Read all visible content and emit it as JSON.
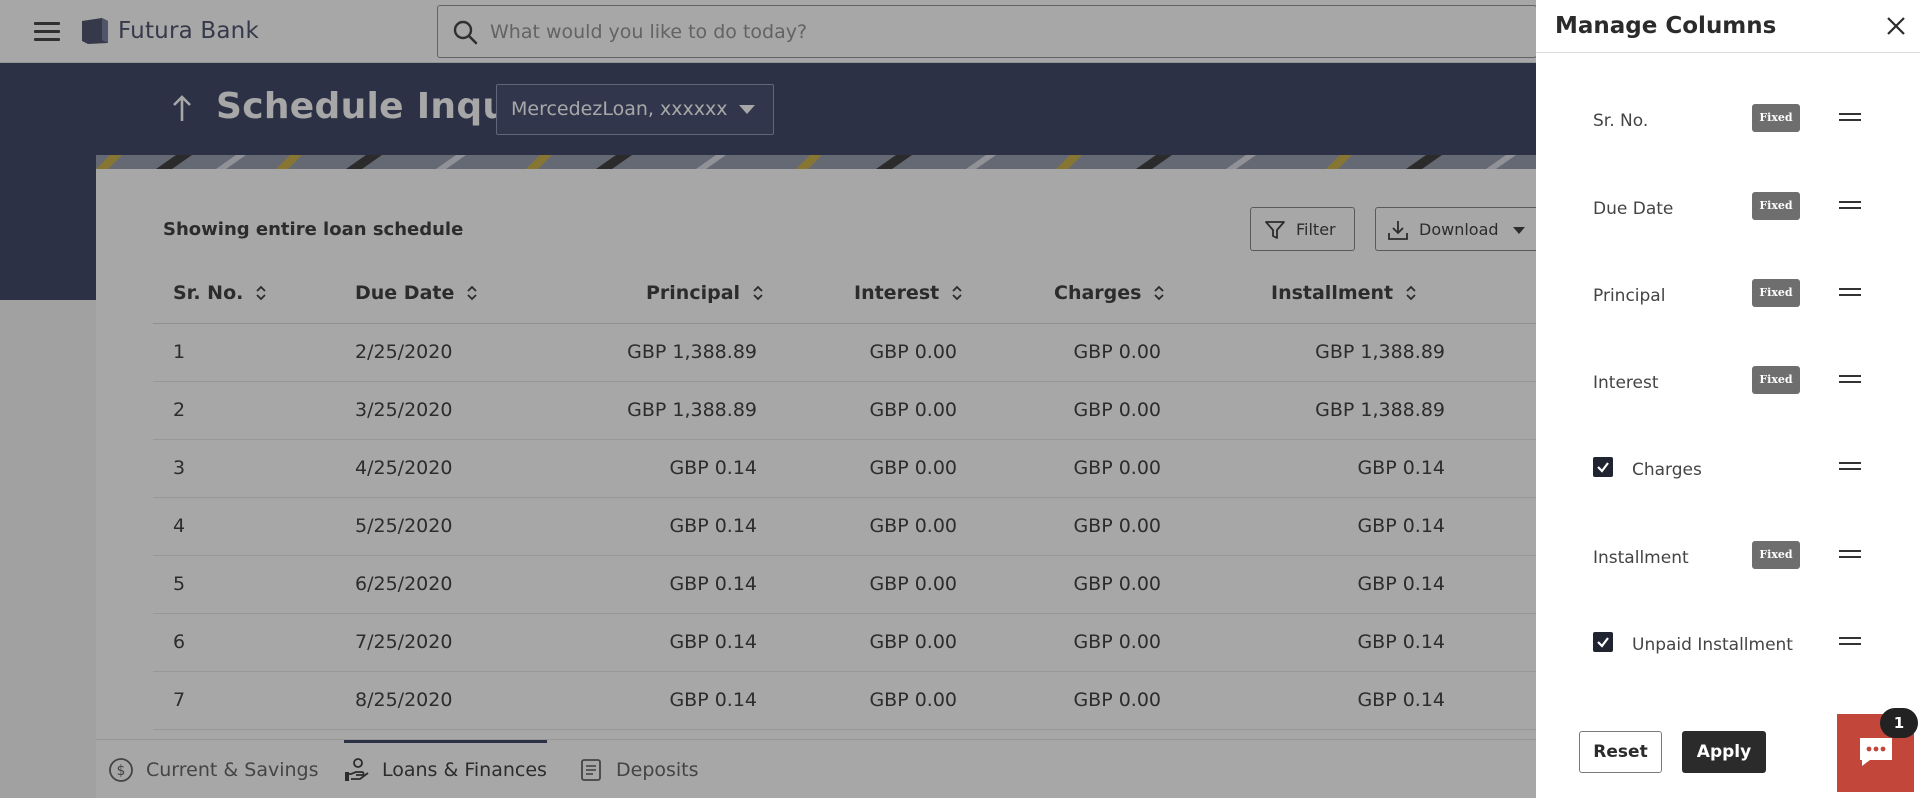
{
  "header": {
    "brand": "Futura Bank",
    "search_placeholder": "What would you like to do today?"
  },
  "page": {
    "title": "Schedule Inquiry",
    "account": "MercedezLoan, xxxxxx",
    "showing_text": "Showing entire loan schedule",
    "filter_label": "Filter",
    "download_label": "Download"
  },
  "table": {
    "columns": [
      "Sr. No.",
      "Due Date",
      "Principal",
      "Interest",
      "Charges",
      "Installment"
    ],
    "rows": [
      [
        "1",
        "2/25/2020",
        "GBP 1,388.89",
        "GBP 0.00",
        "GBP 0.00",
        "GBP 1,388.89"
      ],
      [
        "2",
        "3/25/2020",
        "GBP 1,388.89",
        "GBP 0.00",
        "GBP 0.00",
        "GBP 1,388.89"
      ],
      [
        "3",
        "4/25/2020",
        "GBP 0.14",
        "GBP 0.00",
        "GBP 0.00",
        "GBP 0.14"
      ],
      [
        "4",
        "5/25/2020",
        "GBP 0.14",
        "GBP 0.00",
        "GBP 0.00",
        "GBP 0.14"
      ],
      [
        "5",
        "6/25/2020",
        "GBP 0.14",
        "GBP 0.00",
        "GBP 0.00",
        "GBP 0.14"
      ],
      [
        "6",
        "7/25/2020",
        "GBP 0.14",
        "GBP 0.00",
        "GBP 0.00",
        "GBP 0.14"
      ],
      [
        "7",
        "8/25/2020",
        "GBP 0.14",
        "GBP 0.00",
        "GBP 0.00",
        "GBP 0.14"
      ]
    ]
  },
  "bottom_tabs": [
    {
      "label": "Current & Savings",
      "icon": "dollar-coin-icon",
      "active": false
    },
    {
      "label": "Loans & Finances",
      "icon": "hand-money-icon",
      "active": true
    },
    {
      "label": "Deposits",
      "icon": "deposit-ledger-icon",
      "active": false
    }
  ],
  "panel": {
    "title": "Manage Columns",
    "fixed_label": "Fixed",
    "items": [
      {
        "label": "Sr. No.",
        "fixed": true,
        "checked": false
      },
      {
        "label": "Due Date",
        "fixed": true,
        "checked": false
      },
      {
        "label": "Principal",
        "fixed": true,
        "checked": false
      },
      {
        "label": "Interest",
        "fixed": true,
        "checked": false
      },
      {
        "label": "Charges",
        "fixed": false,
        "checked": true
      },
      {
        "label": "Installment",
        "fixed": true,
        "checked": false
      },
      {
        "label": "Unpaid Installment",
        "fixed": false,
        "checked": true
      }
    ],
    "reset_label": "Reset",
    "apply_label": "Apply"
  },
  "chat": {
    "badge": "1"
  },
  "colors": {
    "brand_navy": "#2b3457",
    "chat_red": "#c2463a",
    "dark": "#2b2b2b"
  }
}
